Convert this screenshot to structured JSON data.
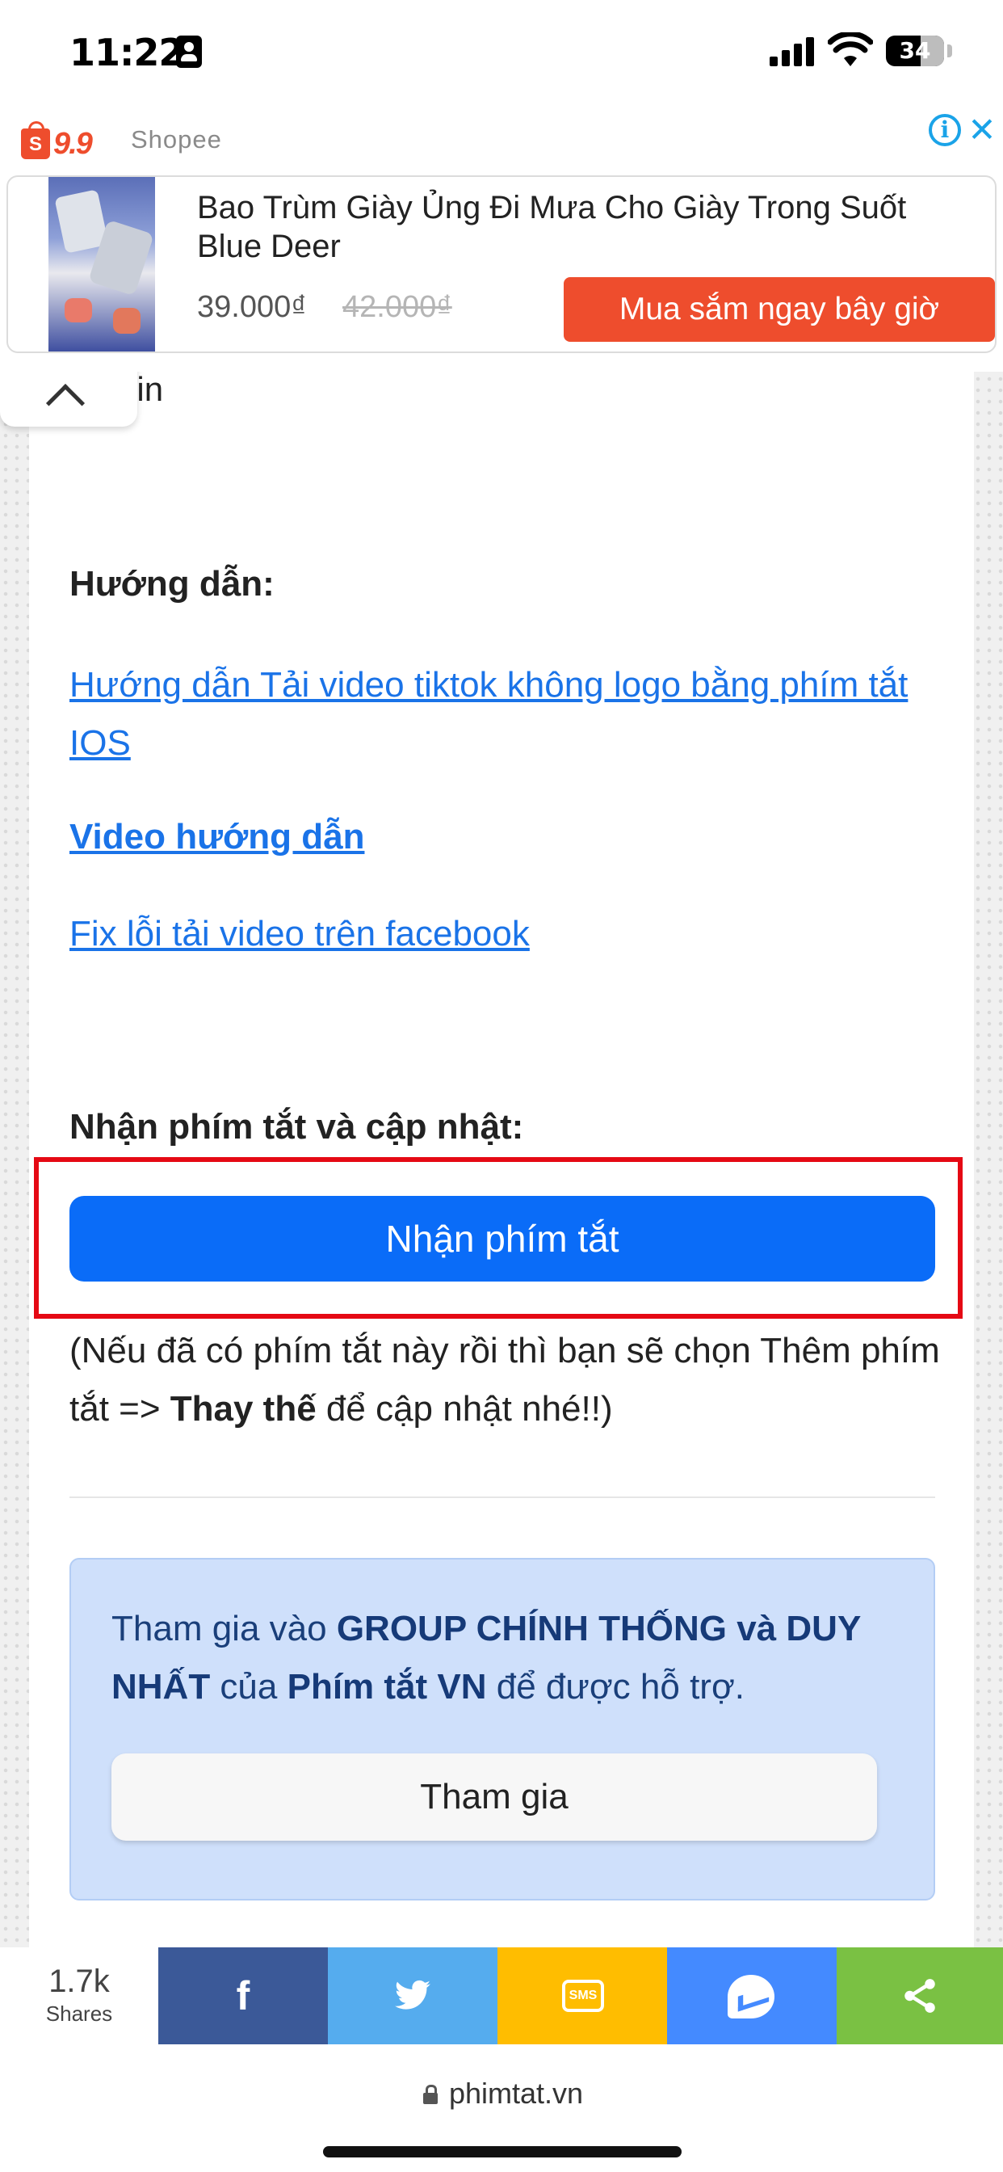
{
  "status_bar": {
    "time": "11:22",
    "battery_level": "34"
  },
  "ad": {
    "brand_badge": "9.9",
    "brand_bag_letter": "S",
    "advertiser": "Shopee",
    "product_title": "Bao Trùm Giày Ủng Đi Mưa Cho Giày Trong Suốt Blue Deer",
    "price": "39.000₫",
    "old_price": "42.000₫",
    "cta_label": "Mua sắm ngay bây giờ",
    "info_glyph": "i",
    "close_glyph": "✕"
  },
  "content": {
    "partial_text": "hin",
    "guide_heading": "Hướng dẫn:",
    "links": [
      "Hướng dẫn Tải video tiktok không logo bằng phím tắt IOS",
      "Video hướng dẫn",
      "Fix lỗi tải video trên facebook"
    ],
    "get_heading": "Nhận phím tắt và cập nhật:",
    "get_button_label": "Nhận phím tắt",
    "note_prefix": "(Nếu đã có phím tắt này rồi thì bạn sẽ chọn Thêm phím tắt => ",
    "note_bold": "Thay thế",
    "note_suffix": " để cập nhật nhé!!)",
    "group": {
      "t1": "Tham gia vào ",
      "b1": "GROUP CHÍNH THỐNG và DUY NHẤT",
      "t2": " của ",
      "b2": "Phím tắt VN",
      "t3": " để được hỗ trợ.",
      "join_label": "Tham gia"
    }
  },
  "share_bar": {
    "count": "1.7k",
    "count_label": "Shares",
    "buttons": [
      {
        "name": "facebook",
        "glyph": "f",
        "color": "#3b5998"
      },
      {
        "name": "twitter",
        "glyph": "🐦",
        "color": "#55acee"
      },
      {
        "name": "sms",
        "glyph": "SMS",
        "color": "#ffbd00"
      },
      {
        "name": "messenger",
        "glyph": "",
        "color": "#448aff"
      },
      {
        "name": "share",
        "glyph": "",
        "color": "#7ac143"
      }
    ]
  },
  "browser": {
    "address": "phimtat.vn"
  }
}
